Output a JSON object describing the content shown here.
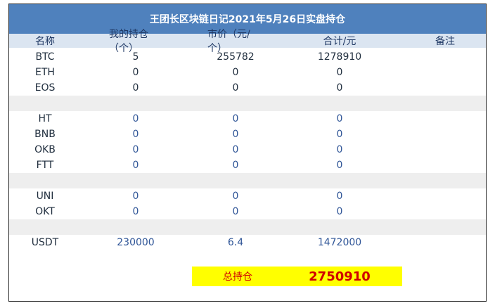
{
  "title": "王团长区块链日记2021年5月26日实盘持仓",
  "columns": {
    "name": "名称",
    "qty": "我的持仓（个）",
    "price": "市价（元/个）",
    "total": "合计/元",
    "note": "备注"
  },
  "rows": [
    {
      "name": "BTC",
      "qty": "5",
      "price": "255782",
      "total": "1278910"
    },
    {
      "name": "ETH",
      "qty": "0",
      "price": "0",
      "total": "0"
    },
    {
      "name": "EOS",
      "qty": "0",
      "price": "0",
      "total": "0"
    },
    {
      "name": "HT",
      "qty": "0",
      "price": "0",
      "total": "0"
    },
    {
      "name": "BNB",
      "qty": "0",
      "price": "0",
      "total": "0"
    },
    {
      "name": "OKB",
      "qty": "0",
      "price": "0",
      "total": "0"
    },
    {
      "name": "FTT",
      "qty": "0",
      "price": "0",
      "total": "0"
    },
    {
      "name": "UNI",
      "qty": "0",
      "price": "0",
      "total": "0"
    },
    {
      "name": "OKT",
      "qty": "0",
      "price": "0",
      "total": "0"
    },
    {
      "name": "USDT",
      "qty": "230000",
      "price": "6.4",
      "total": "1472000"
    }
  ],
  "summary": {
    "label": "总持仓",
    "value": "2750910"
  },
  "colors": {
    "title_bg": "#4f81bd",
    "header_bg": "#dbe5f1",
    "total_bg": "#ffff00",
    "total_text": "#d00000"
  }
}
